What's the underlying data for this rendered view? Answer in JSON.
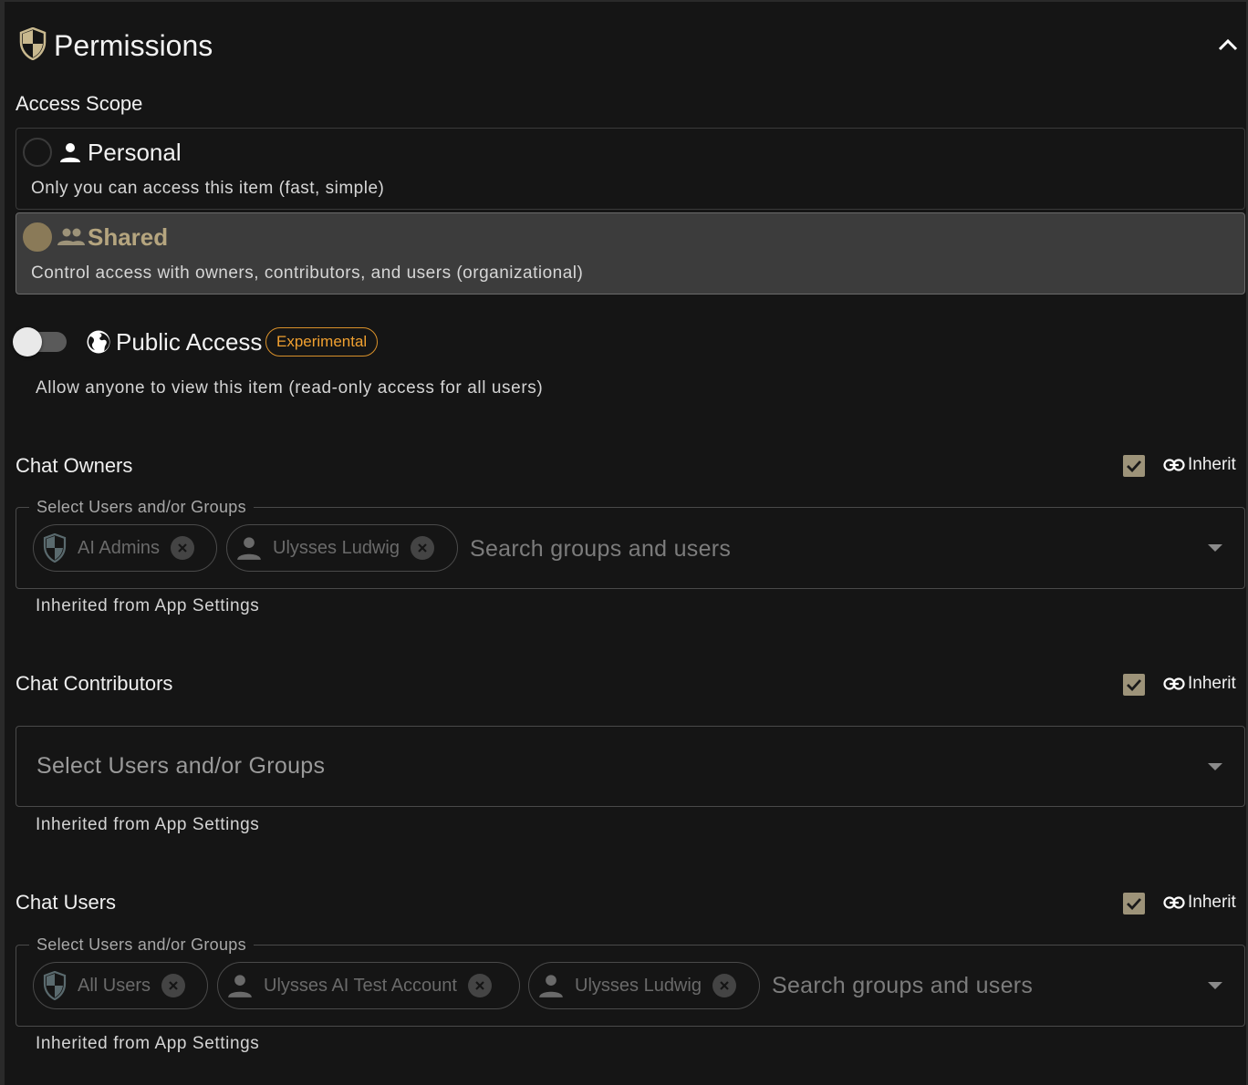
{
  "header": {
    "title": "Permissions"
  },
  "access_scope": {
    "label": "Access Scope",
    "options": [
      {
        "title": "Personal",
        "description": "Only you can access this item (fast, simple)",
        "selected": false
      },
      {
        "title": "Shared",
        "description": "Control access with owners, contributors, and users (organizational)",
        "selected": true
      }
    ]
  },
  "public_access": {
    "label": "Public Access",
    "badge": "Experimental",
    "enabled": false,
    "description": "Allow anyone to view this item (read-only access for all users)"
  },
  "chat_owners": {
    "label": "Chat Owners",
    "inherit_label": "Inherit",
    "inherit_checked": true,
    "field_label": "Select Users and/or Groups",
    "chips": [
      {
        "label": "AI Admins",
        "type": "group"
      },
      {
        "label": "Ulysses Ludwig",
        "type": "user"
      }
    ],
    "search_placeholder": "Search groups and users",
    "helper": "Inherited from App Settings"
  },
  "chat_contributors": {
    "label": "Chat Contributors",
    "inherit_label": "Inherit",
    "inherit_checked": true,
    "placeholder": "Select Users and/or Groups",
    "helper": "Inherited from App Settings"
  },
  "chat_users": {
    "label": "Chat Users",
    "inherit_label": "Inherit",
    "inherit_checked": true,
    "field_label": "Select Users and/or Groups",
    "chips": [
      {
        "label": "All Users",
        "type": "group"
      },
      {
        "label": "Ulysses AI Test Account",
        "type": "user"
      },
      {
        "label": "Ulysses Ludwig",
        "type": "user"
      }
    ],
    "search_placeholder": "Search groups and users",
    "helper": "Inherited from App Settings"
  },
  "colors": {
    "accent": "#8a7a58",
    "badge": "#f0a030",
    "checkbox": "#9d9379"
  }
}
